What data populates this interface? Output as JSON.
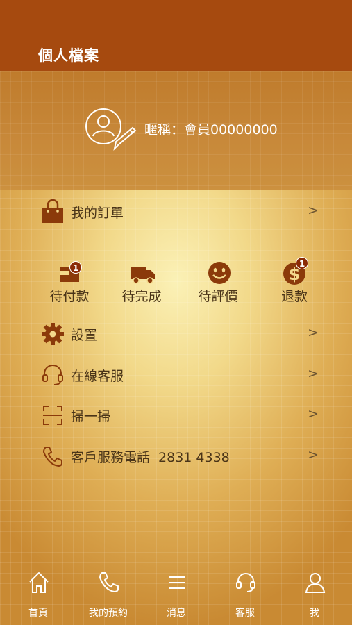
{
  "header": {
    "title": "個人檔案"
  },
  "profile": {
    "nickname": "暱稱：會員00000000"
  },
  "orders": {
    "label": "我的訂單",
    "chevron": ">"
  },
  "order_status": [
    {
      "label": "待付款",
      "icon": "wallet-icon",
      "badge": "1"
    },
    {
      "label": "待完成",
      "icon": "truck-icon",
      "badge": ""
    },
    {
      "label": "待評價",
      "icon": "smiley-icon",
      "badge": ""
    },
    {
      "label": "退款",
      "icon": "dollar-icon",
      "badge": "1"
    }
  ],
  "menu": [
    {
      "label": "設置",
      "icon": "gear-icon",
      "chevron": ">"
    },
    {
      "label": "在線客服",
      "icon": "headset-icon",
      "chevron": ">"
    },
    {
      "label": "掃一掃",
      "icon": "scan-icon",
      "chevron": ">"
    },
    {
      "label": "客戶服務電話",
      "phone": "2831 4338",
      "icon": "phone-icon",
      "chevron": ">"
    }
  ],
  "tabbar": [
    {
      "label": "首頁",
      "icon": "home-icon"
    },
    {
      "label": "我的預約",
      "icon": "phone-icon"
    },
    {
      "label": "消息",
      "icon": "menu-icon"
    },
    {
      "label": "客服",
      "icon": "headset-icon"
    },
    {
      "label": "我",
      "icon": "user-icon"
    }
  ],
  "colors": {
    "header": "#a64a0f",
    "accent": "#8b2a05",
    "text": "#4a3418"
  }
}
